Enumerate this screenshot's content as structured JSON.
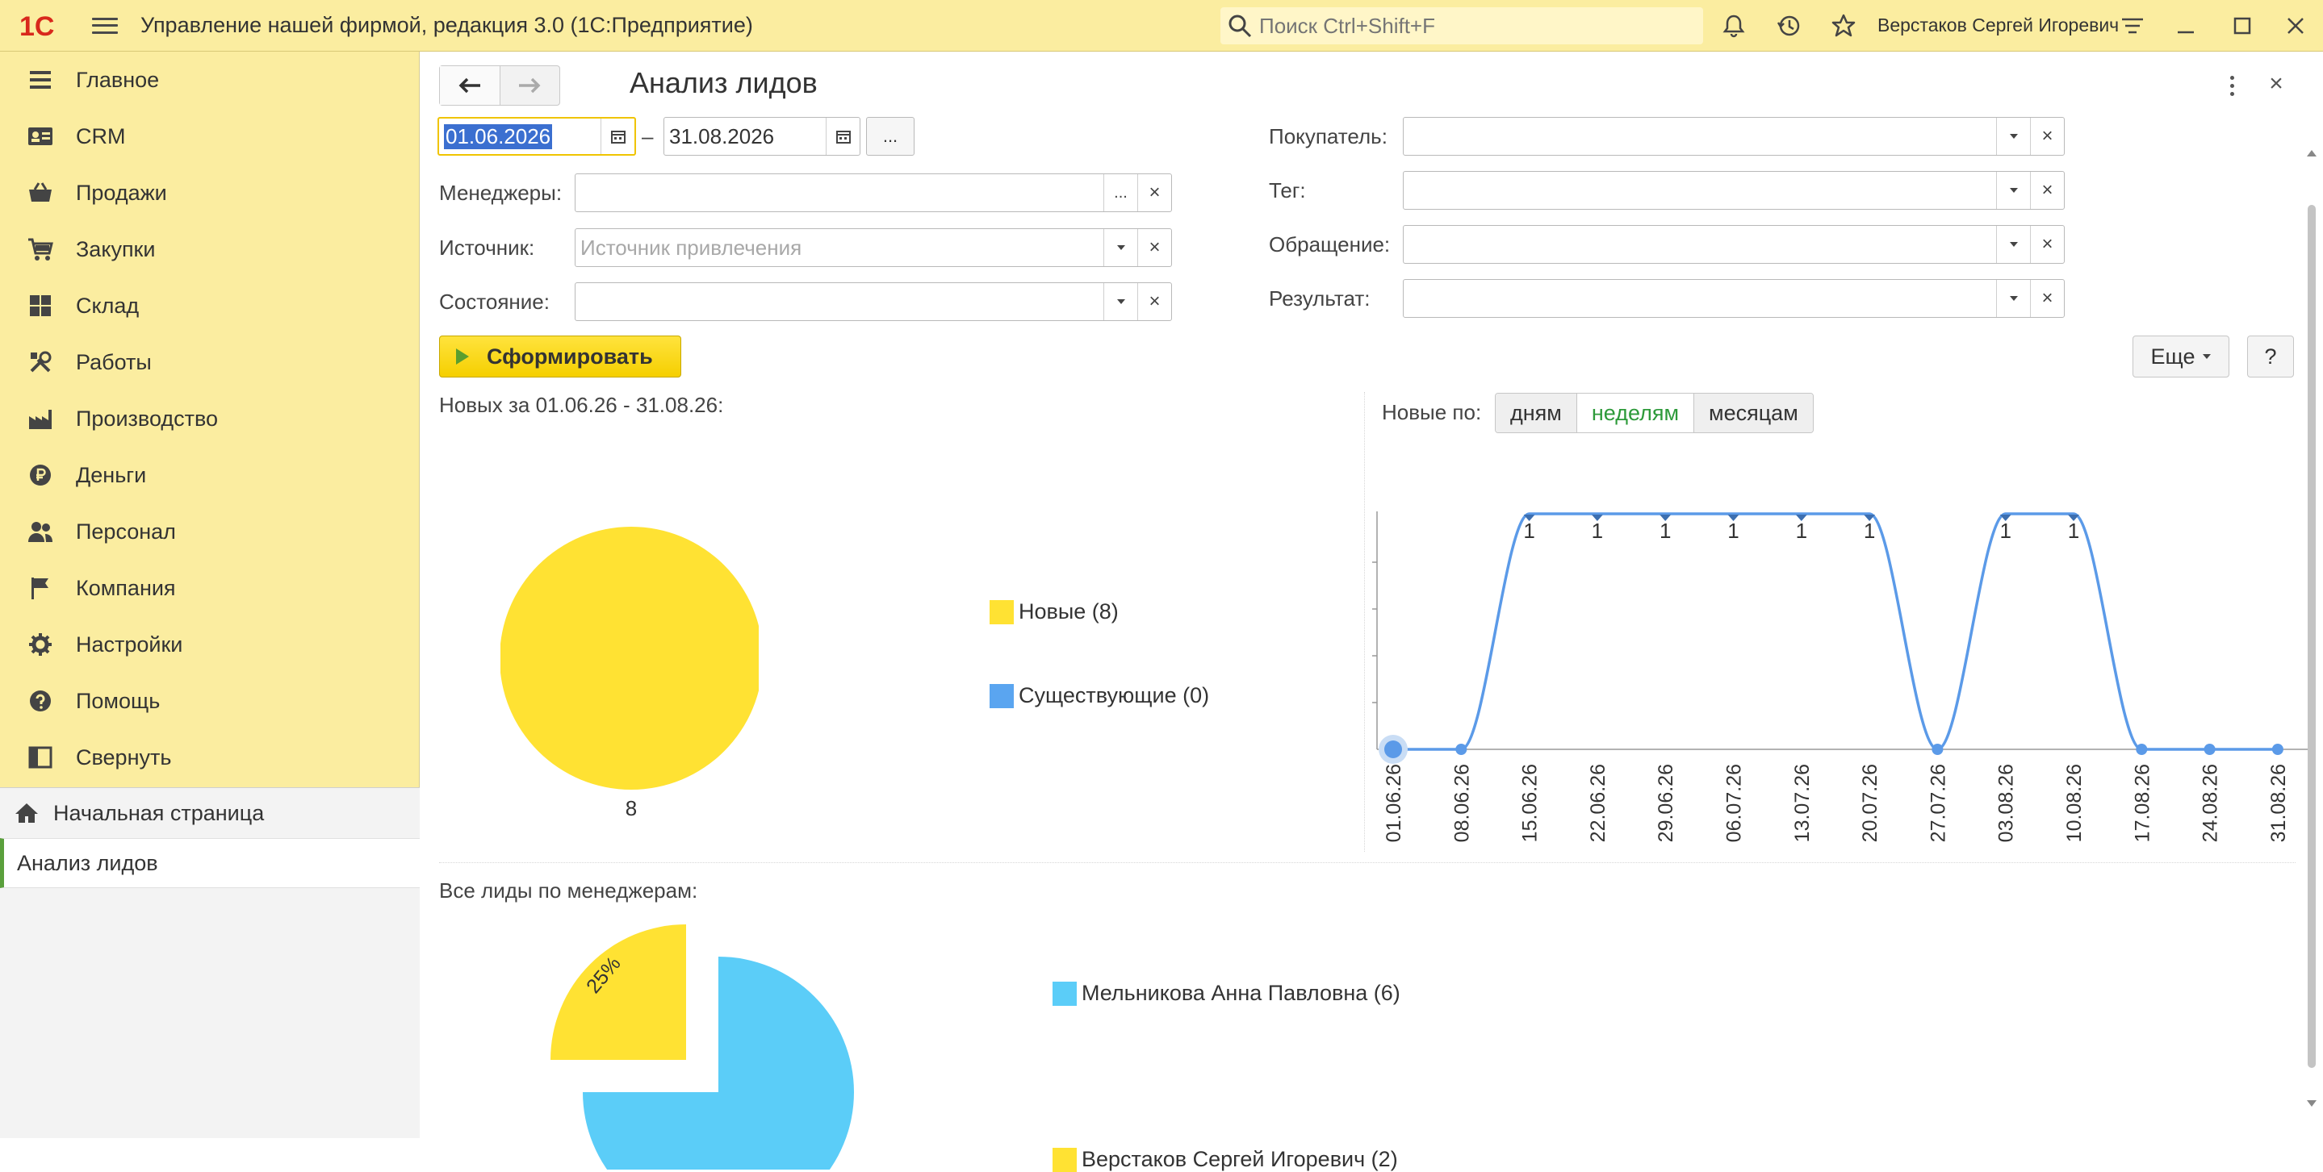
{
  "app": {
    "logo_text": "1С",
    "title": "Управление нашей фирмой, редакция 3.0  (1С:Предприятие)",
    "search_placeholder": "Поиск Ctrl+Shift+F",
    "user": "Верстаков Сергей Игоревич"
  },
  "sidebar": {
    "items": [
      {
        "label": "Главное",
        "icon": "menu-list-icon"
      },
      {
        "label": "CRM",
        "icon": "contact-card-icon"
      },
      {
        "label": "Продажи",
        "icon": "basket-icon"
      },
      {
        "label": "Закупки",
        "icon": "cart-icon"
      },
      {
        "label": "Склад",
        "icon": "warehouse-grid-icon"
      },
      {
        "label": "Работы",
        "icon": "tools-icon"
      },
      {
        "label": "Производство",
        "icon": "factory-icon"
      },
      {
        "label": "Деньги",
        "icon": "ruble-icon"
      },
      {
        "label": "Персонал",
        "icon": "people-icon"
      },
      {
        "label": "Компания",
        "icon": "flag-icon"
      },
      {
        "label": "Настройки",
        "icon": "gear-icon"
      },
      {
        "label": "Помощь",
        "icon": "help-icon"
      },
      {
        "label": "Свернуть",
        "icon": "collapse-panel-icon"
      }
    ],
    "home": "Начальная страница",
    "open_document": "Анализ лидов"
  },
  "form": {
    "title": "Анализ лидов",
    "date_from": "01.06.2026",
    "date_sep": "–",
    "date_to": "31.08.2026",
    "period_button": "...",
    "managers_label": "Менеджеры:",
    "managers_value": "",
    "source_label": "Источник:",
    "source_placeholder": "Источник привлечения",
    "state_label": "Состояние:",
    "state_value": "",
    "buyer_label": "Покупатель:",
    "tag_label": "Тег:",
    "appeal_label": "Обращение:",
    "result_label": "Результат:",
    "generate_button": "Сформировать",
    "more_button": "Еще",
    "help_button": "?"
  },
  "new_leads": {
    "title": "Новых за 01.06.26 - 31.08.26:"
  },
  "weekly": {
    "label": "Новые по:",
    "periods": [
      "дням",
      "неделям",
      "месяцам"
    ],
    "selected": "неделям"
  },
  "managers_section": {
    "title": "Все лиды по менеджерам:"
  },
  "colors": {
    "yellow": "#ffe233",
    "blue": "#5aa5f0",
    "cyan": "#5bcdf8",
    "line": "#5b9ae8"
  },
  "chart_data": [
    {
      "type": "pie",
      "categories": [
        "Новые (8)",
        "Существующие (0)"
      ],
      "values": [
        8,
        0
      ],
      "data_labels": [
        "8",
        ""
      ]
    },
    {
      "type": "line",
      "x": [
        "01.06.26",
        "08.06.26",
        "15.06.26",
        "22.06.26",
        "29.06.26",
        "06.07.26",
        "13.07.26",
        "20.07.26",
        "27.07.26",
        "03.08.26",
        "10.08.26",
        "17.08.26",
        "24.08.26",
        "31.08.26"
      ],
      "values": [
        0,
        0,
        1,
        1,
        1,
        1,
        1,
        1,
        0,
        1,
        1,
        0,
        0,
        0
      ],
      "ylim": [
        0,
        1
      ],
      "grid": false
    },
    {
      "type": "pie",
      "categories": [
        "Мельникова Анна Павловна (6)",
        "Верстаков Сергей Игоревич (2)"
      ],
      "values": [
        6,
        2
      ],
      "data_labels": [
        "",
        "25%"
      ]
    }
  ]
}
